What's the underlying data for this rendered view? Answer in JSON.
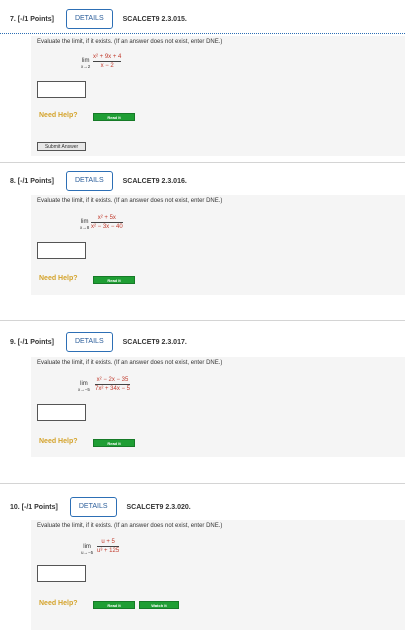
{
  "questions": [
    {
      "number": "7. [-/1 Points]",
      "details": "DETAILS",
      "code": "SCALCET9 2.3.015.",
      "prompt": "Evaluate the limit, if it exists. (If an answer does not exist, enter DNE.)",
      "lim_word": "lim",
      "lim_sub": "x→2",
      "numerator": "x² + 9x + 4",
      "denominator": "x − 2",
      "need_help": "Need Help?",
      "read_it": "Read It",
      "submit": "Submit Answer"
    },
    {
      "number": "8. [-/1 Points]",
      "details": "DETAILS",
      "code": "SCALCET9 2.3.016.",
      "prompt": "Evaluate the limit, if it exists. (If an answer does not exist, enter DNE.)",
      "lim_word": "lim",
      "lim_sub": "x→8",
      "numerator": "x² + 5x",
      "denominator": "x² − 3x − 40",
      "need_help": "Need Help?",
      "read_it": "Read It"
    },
    {
      "number": "9. [-/1 Points]",
      "details": "DETAILS",
      "code": "SCALCET9 2.3.017.",
      "prompt": "Evaluate the limit, if it exists. (If an answer does not exist, enter DNE.)",
      "lim_word": "lim",
      "lim_sub": "x→−5",
      "numerator": "x² − 2x − 35",
      "denominator": "7x² + 34x − 5",
      "need_help": "Need Help?",
      "read_it": "Read It"
    },
    {
      "number": "10. [-/1 Points]",
      "details": "DETAILS",
      "code": "SCALCET9 2.3.020.",
      "prompt": "Evaluate the limit, if it exists. (If an answer does not exist, enter DNE.)",
      "lim_word": "lim",
      "lim_sub": "u→−5",
      "numerator": "u + 5",
      "denominator": "u³ + 125",
      "need_help": "Need Help?",
      "read_it": "Read It",
      "watch_it": "Watch It"
    }
  ],
  "colors": {
    "accent": "#2d6fb5",
    "need_help": "#d4a32b",
    "help_button": "#1f9e34",
    "math": "#c0392b"
  }
}
